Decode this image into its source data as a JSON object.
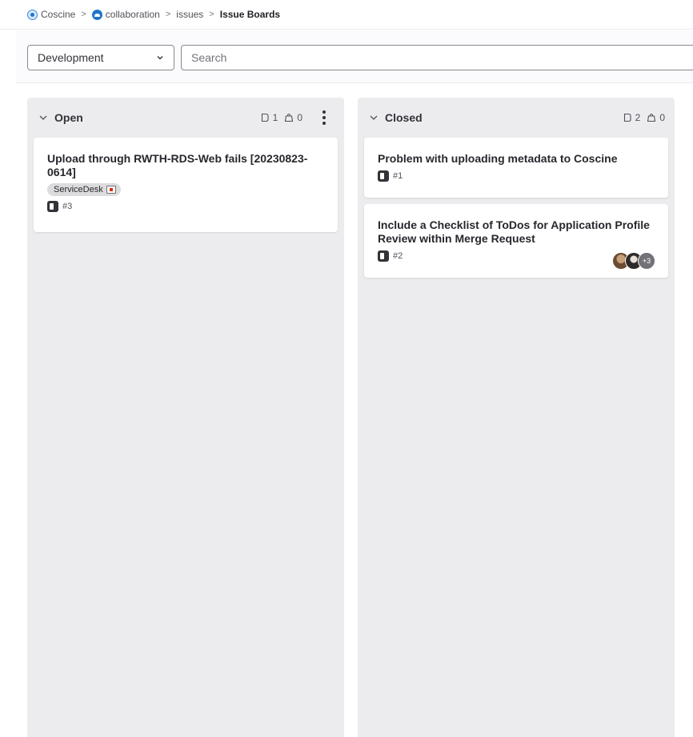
{
  "breadcrumb": {
    "items": [
      {
        "label": "Coscine",
        "icon": "coscine-project-icon"
      },
      {
        "label": "collaboration",
        "icon": "collaboration-project-icon"
      },
      {
        "label": "issues"
      },
      {
        "label": "Issue Boards"
      }
    ],
    "separator": ">"
  },
  "filter": {
    "board": "Development",
    "search_placeholder": "Search",
    "search_value": ""
  },
  "lists": [
    {
      "title": "Open",
      "issue_count": "1",
      "weight_count": "0",
      "cards": [
        {
          "title": "Upload through RWTH-RDS-Web fails [20230823-0614]",
          "label": "ServiceDesk",
          "number": "#3"
        }
      ]
    },
    {
      "title": "Closed",
      "issue_count": "2",
      "weight_count": "0",
      "cards": [
        {
          "title": "Problem with uploading metadata to Coscine",
          "number": "#1"
        },
        {
          "title": "Include a Checklist of ToDos for Application Profile Review within Merge Request",
          "number": "#2",
          "assignees_more": "+3"
        }
      ]
    }
  ],
  "colors": {
    "list_bg": "#ececef",
    "card_bg": "#ffffff",
    "accent": "#1f75cb",
    "label_bg": "#dcdcde"
  }
}
